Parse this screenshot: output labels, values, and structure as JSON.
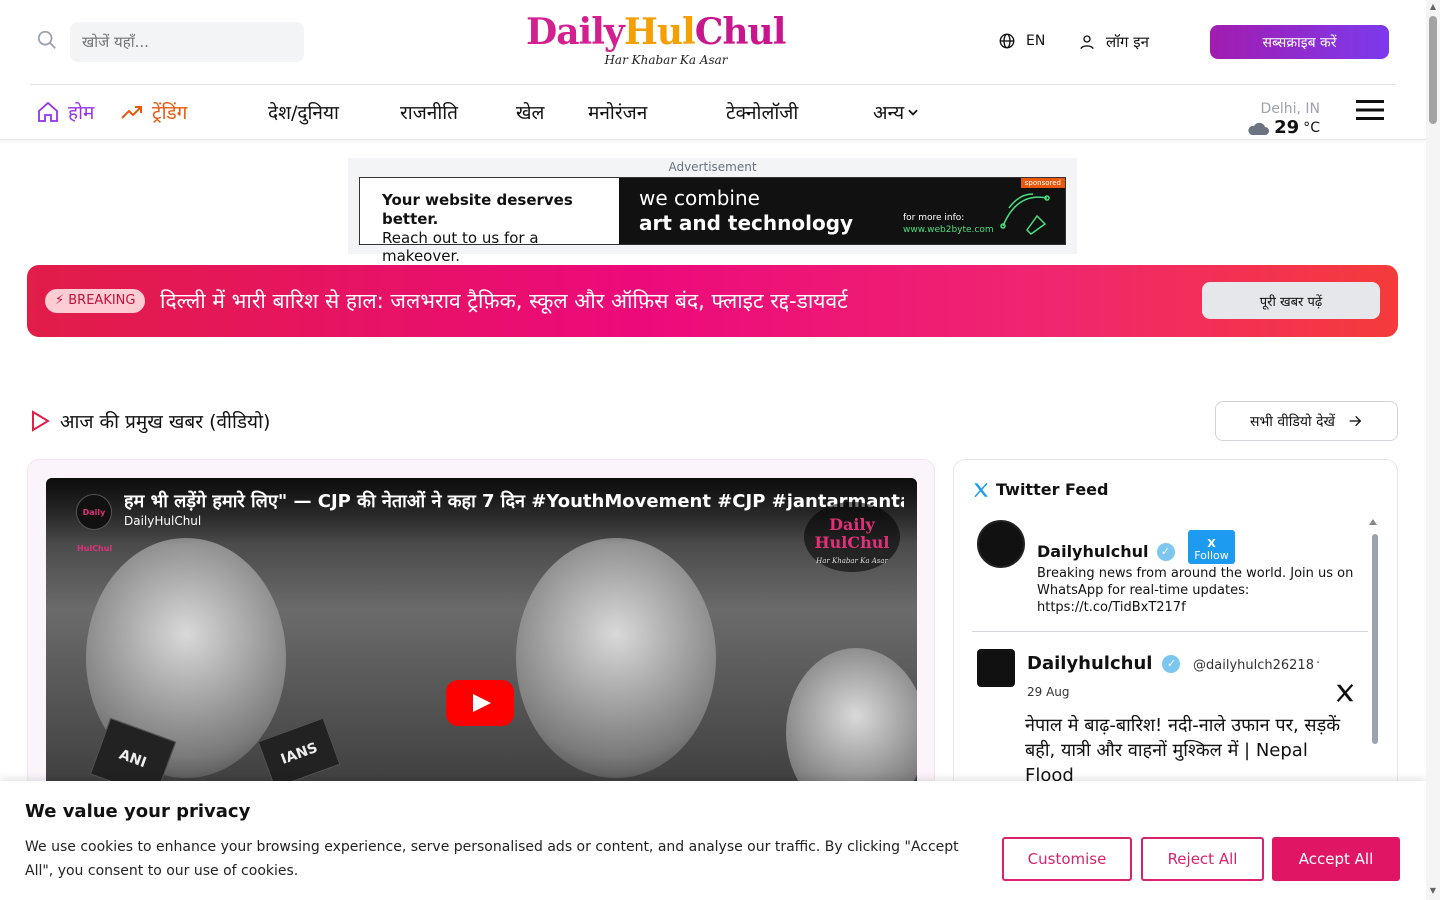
{
  "header": {
    "search_placeholder": "खोजें यहाँ...",
    "logo_part1": "Daily",
    "logo_part2": "Hul",
    "logo_part3": "Chul",
    "logo_tagline": "Har Khabar Ka Asar",
    "lang": "EN",
    "login": "लॉग इन",
    "subscribe": "सब्सक्राइब करें"
  },
  "nav": {
    "items": [
      {
        "label": "होम"
      },
      {
        "label": "ट्रेंडिंग"
      },
      {
        "label": "देश/दुनिया"
      },
      {
        "label": "राजनीति"
      },
      {
        "label": "खेल"
      },
      {
        "label": "मनोरंजन"
      },
      {
        "label": "टेक्नोलॉजी"
      },
      {
        "label": "अन्य"
      }
    ],
    "colors": {
      "home": "#9333ea",
      "trending": "#ea580c"
    }
  },
  "weather": {
    "city": "Delhi, IN",
    "temp": "29",
    "unit": "°C"
  },
  "ad": {
    "label": "Advertisement",
    "left_line1": "Your website deserves better.",
    "left_line2": "Reach out to us for a makeover.",
    "right_line1": "we combine",
    "right_line2": "art and technology",
    "info_label": "for more info:",
    "info_url": "www.web2byte.com",
    "sponsored": "sponsored"
  },
  "breaking": {
    "badge": "⚡ BREAKING",
    "headline": "दिल्ली में भारी बारिश से हाल: जलभराव ट्रैफ़िक, स्कूल और ऑफ़िस बंद, फ्लाइट रद्द-डायवर्ट",
    "button": "पूरी खबर पढ़ें"
  },
  "section": {
    "title": "आज की प्रमुख खबर (वीडियो)",
    "view_all": "सभी वीडियो देखें"
  },
  "video": {
    "title": "हम भी लड़ेंगे हमारे लिए\" — CJP की नेताओं ने कहा 7 दिन #YouthMovement #CJP #jantarmantar",
    "channel": "DailyHulChul",
    "channel_logo": "Daily HulChul",
    "watermark": "Daily HulChul",
    "watermark_tag": "Har Khabar Ka Asar",
    "mic1": "ANI",
    "mic2": "IANS"
  },
  "twitter": {
    "header": "Twitter Feed",
    "profile_name": "Dailyhulchul",
    "follow_label": "Follow",
    "bio": "Breaking news from around the world. Join us on WhatsApp for real-time updates: https://t.co/TidBxT217f",
    "tweet_name": "Dailyhulchul",
    "tweet_handle": "@dailyhulch26218",
    "tweet_dot": "·",
    "tweet_date": "29 Aug",
    "tweet_text": "नेपाल मे बाढ़-बारिश! नदी-नाले उफान पर, सड़कें बही, यात्री और वाहनों मुश्किल में | Nepal Flood"
  },
  "cookie": {
    "title": "We value your privacy",
    "text": "We use cookies to enhance your browsing experience, serve personalised ads or content, and analyse our traffic. By clicking \"Accept All\", you consent to our use of cookies.",
    "customise": "Customise",
    "reject": "Reject All",
    "accept": "Accept All",
    "accent": "#e01563"
  }
}
